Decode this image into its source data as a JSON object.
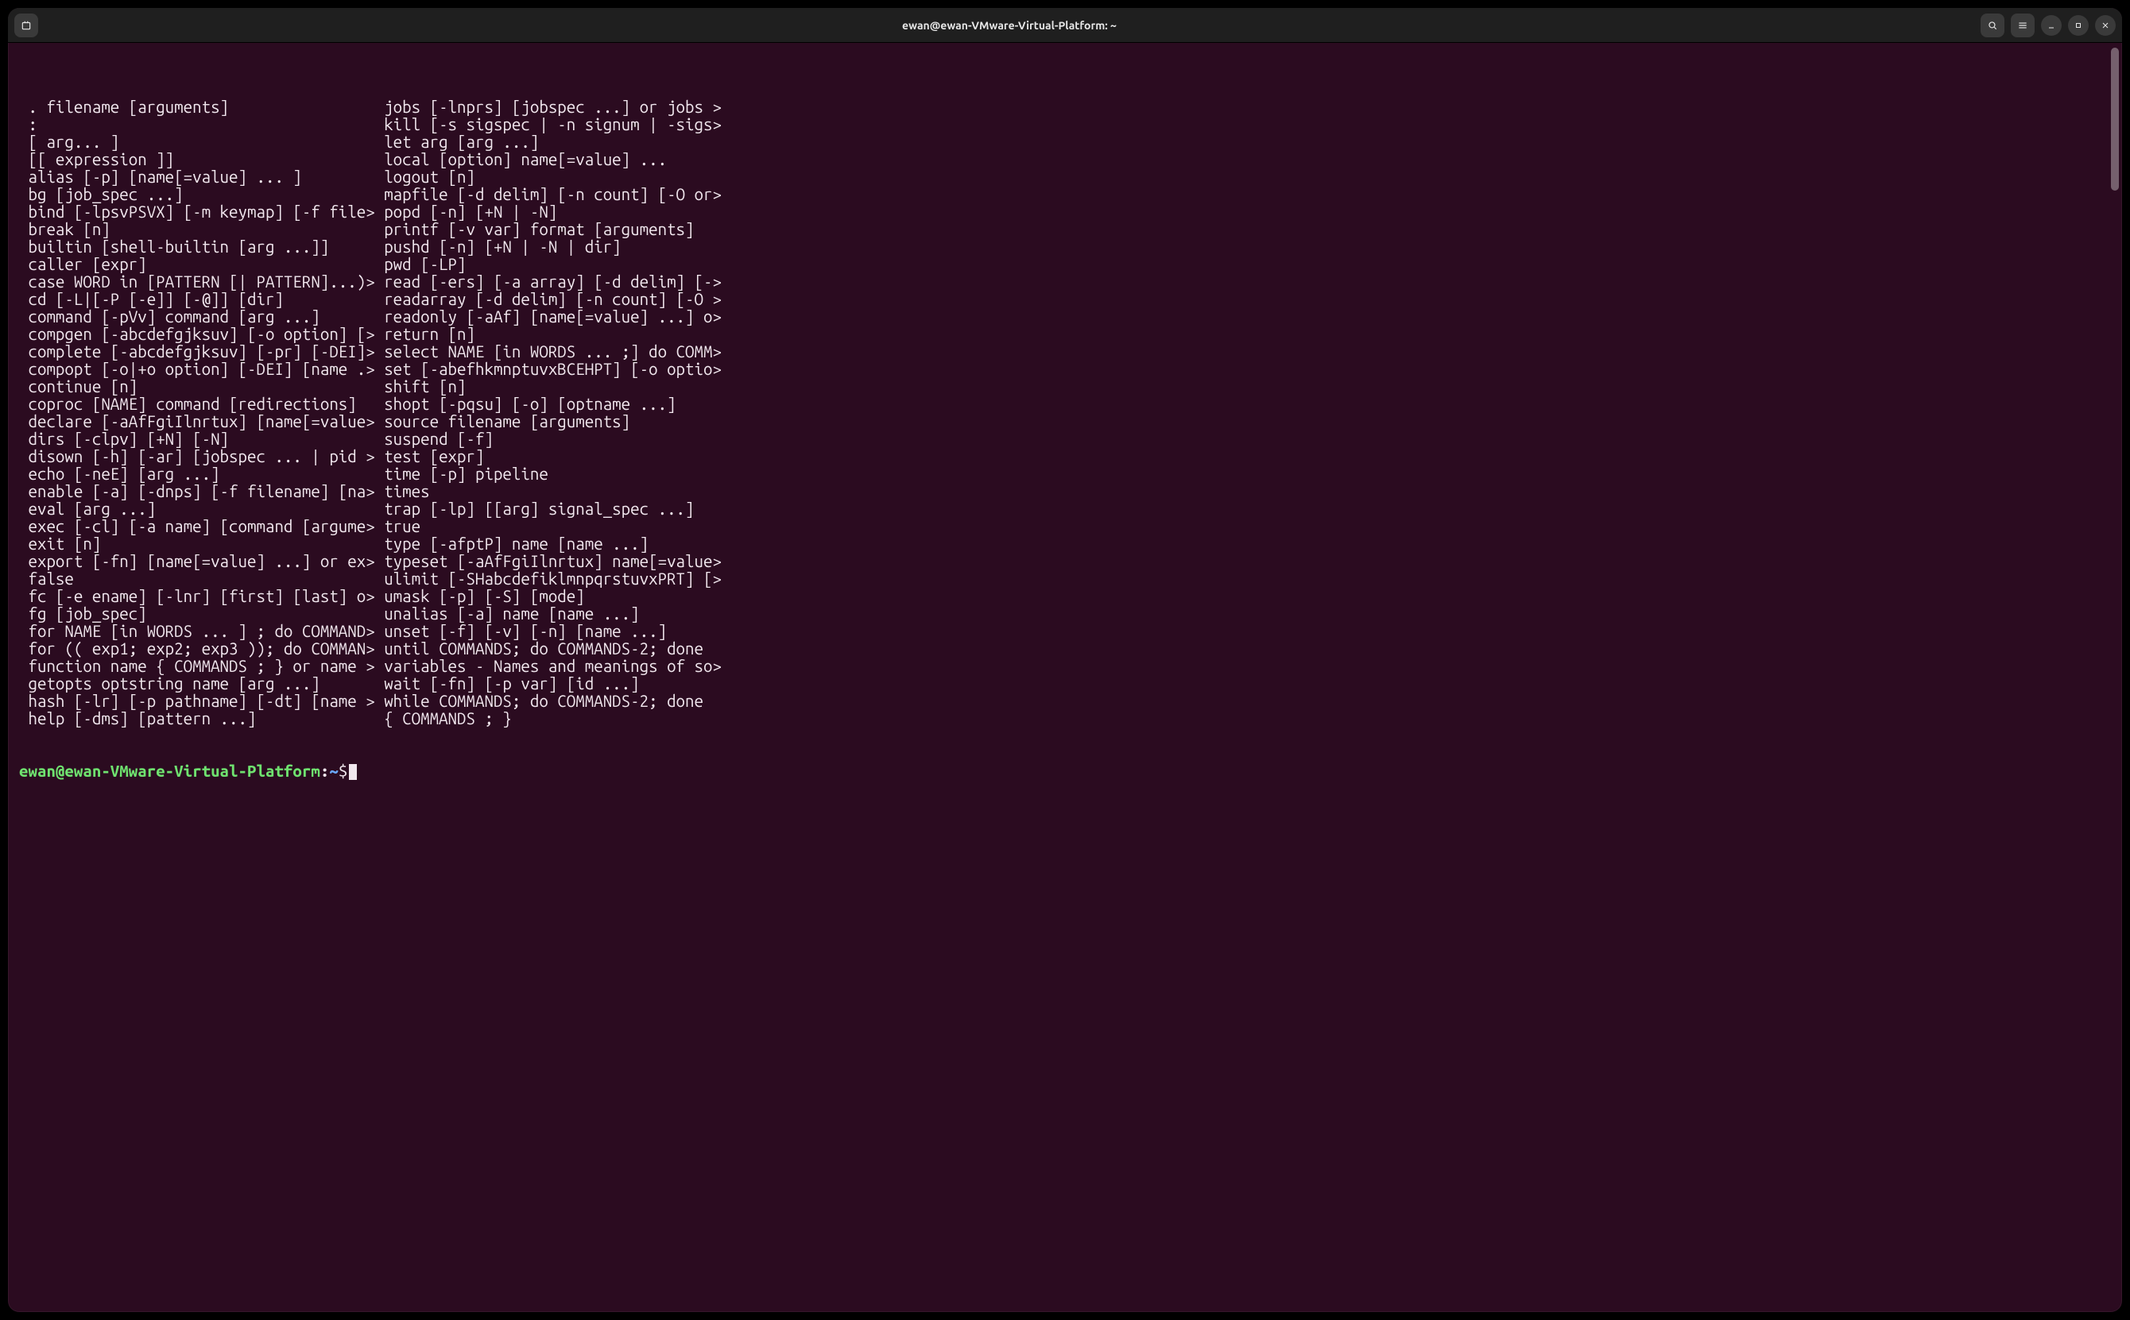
{
  "titlebar": {
    "title": "ewan@ewan-VMware-Virtual-Platform: ~"
  },
  "terminal": {
    "col1": [
      " . filename [arguments]",
      " :",
      " [ arg... ]",
      " [[ expression ]]",
      " alias [-p] [name[=value] ... ]",
      " bg [job_spec ...]",
      " bind [-lpsvPSVX] [-m keymap] [-f file>",
      " break [n]",
      " builtin [shell-builtin [arg ...]]",
      " caller [expr]",
      " case WORD in [PATTERN [| PATTERN]...)>",
      " cd [-L|[-P [-e]] [-@]] [dir]",
      " command [-pVv] command [arg ...]",
      " compgen [-abcdefgjksuv] [-o option] [>",
      " complete [-abcdefgjksuv] [-pr] [-DEI]>",
      " compopt [-o|+o option] [-DEI] [name .>",
      " continue [n]",
      " coproc [NAME] command [redirections]",
      " declare [-aAfFgiIlnrtux] [name[=value>",
      " dirs [-clpv] [+N] [-N]",
      " disown [-h] [-ar] [jobspec ... | pid >",
      " echo [-neE] [arg ...]",
      " enable [-a] [-dnps] [-f filename] [na>",
      " eval [arg ...]",
      " exec [-cl] [-a name] [command [argume>",
      " exit [n]",
      " export [-fn] [name[=value] ...] or ex>",
      " false",
      " fc [-e ename] [-lnr] [first] [last] o>",
      " fg [job_spec]",
      " for NAME [in WORDS ... ] ; do COMMAND>",
      " for (( exp1; exp2; exp3 )); do COMMAN>",
      " function name { COMMANDS ; } or name >",
      " getopts optstring name [arg ...]",
      " hash [-lr] [-p pathname] [-dt] [name >",
      " help [-dms] [pattern ...]"
    ],
    "col2": [
      "jobs [-lnprs] [jobspec ...] or jobs >",
      "kill [-s sigspec | -n signum | -sigs>",
      "let arg [arg ...]",
      "local [option] name[=value] ...",
      "logout [n]",
      "mapfile [-d delim] [-n count] [-O or>",
      "popd [-n] [+N | -N]",
      "printf [-v var] format [arguments]",
      "pushd [-n] [+N | -N | dir]",
      "pwd [-LP]",
      "read [-ers] [-a array] [-d delim] [->",
      "readarray [-d delim] [-n count] [-O >",
      "readonly [-aAf] [name[=value] ...] o>",
      "return [n]",
      "select NAME [in WORDS ... ;] do COMM>",
      "set [-abefhkmnptuvxBCEHPT] [-o optio>",
      "shift [n]",
      "shopt [-pqsu] [-o] [optname ...]",
      "source filename [arguments]",
      "suspend [-f]",
      "test [expr]",
      "time [-p] pipeline",
      "times",
      "trap [-lp] [[arg] signal_spec ...]",
      "true",
      "type [-afptP] name [name ...]",
      "typeset [-aAfFgiIlnrtux] name[=value>",
      "ulimit [-SHabcdefiklmnpqrstuvxPRT] [>",
      "umask [-p] [-S] [mode]",
      "unalias [-a] name [name ...]",
      "unset [-f] [-v] [-n] [name ...]",
      "until COMMANDS; do COMMANDS-2; done",
      "variables - Names and meanings of so>",
      "wait [-fn] [-p var] [id ...]",
      "while COMMANDS; do COMMANDS-2; done",
      "{ COMMANDS ; }"
    ],
    "prompt": {
      "user_host": "ewan@ewan-VMware-Virtual-Platform",
      "colon": ":",
      "path": "~",
      "dollar": "$"
    }
  }
}
